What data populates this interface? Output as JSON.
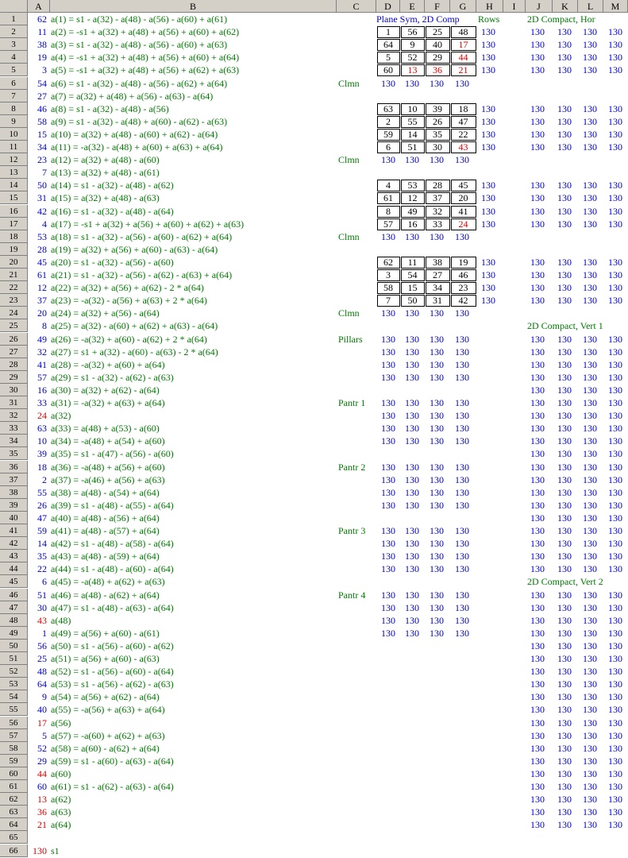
{
  "columns": [
    "A",
    "B",
    "C",
    "D",
    "E",
    "F",
    "G",
    "H",
    "I",
    "J",
    "K",
    "L",
    "M"
  ],
  "rows": [
    {
      "a": "62",
      "b": "a(1) = s1 - a(32) - a(48) - a(56) - a(60) + a(61)"
    },
    {
      "a": "11",
      "b": "a(2) = -s1 + a(32) + a(48) + a(56) + a(60) + a(62)"
    },
    {
      "a": "38",
      "b": "a(3) = s1 - a(32) - a(48) - a(56) - a(60) + a(63)"
    },
    {
      "a": "19",
      "b": "a(4) = -s1 + a(32) + a(48) + a(56) + a(60) + a(64)"
    },
    {
      "a": "3",
      "b": "a(5) = -s1 + a(32) + a(48) + a(56) + a(62) + a(63)"
    },
    {
      "a": "54",
      "b": "a(6) = s1 - a(32) - a(48) - a(56) - a(62) + a(64)"
    },
    {
      "a": "27",
      "b": "a(7) = a(32) + a(48) + a(56) - a(63) - a(64)"
    },
    {
      "a": "46",
      "b": "a(8) = s1 - a(32) - a(48) - a(56)"
    },
    {
      "a": "58",
      "b": "a(9) = s1 - a(32) - a(48) + a(60) - a(62) - a(63)"
    },
    {
      "a": "15",
      "b": "a(10) = a(32) + a(48) - a(60) + a(62) - a(64)"
    },
    {
      "a": "34",
      "b": "a(11) = -a(32) - a(48) + a(60) + a(63) + a(64)"
    },
    {
      "a": "23",
      "b": "a(12) = a(32) + a(48) - a(60)"
    },
    {
      "a": "7",
      "b": "a(13) = a(32) + a(48) - a(61)"
    },
    {
      "a": "50",
      "b": "a(14) = s1 - a(32) - a(48) - a(62)"
    },
    {
      "a": "31",
      "b": "a(15) = a(32) + a(48) - a(63)"
    },
    {
      "a": "42",
      "b": "a(16) = s1 - a(32) - a(48) - a(64)"
    },
    {
      "a": "4",
      "b": "a(17) = -s1 + a(32) + a(56) + a(60) + a(62) + a(63)"
    },
    {
      "a": "53",
      "b": "a(18) = s1 - a(32) - a(56) - a(60) - a(62) + a(64)"
    },
    {
      "a": "28",
      "b": "a(19) = a(32) + a(56) + a(60) - a(63) - a(64)"
    },
    {
      "a": "45",
      "b": "a(20) = s1 - a(32) - a(56) - a(60)"
    },
    {
      "a": "61",
      "b": "a(21) = s1 - a(32) - a(56) - a(62) - a(63) + a(64)"
    },
    {
      "a": "12",
      "b": "a(22) = a(32) + a(56) + a(62) - 2 * a(64)"
    },
    {
      "a": "37",
      "b": "a(23) = -a(32) - a(56) + a(63) + 2 * a(64)"
    },
    {
      "a": "20",
      "b": "a(24) = a(32) + a(56) - a(64)"
    },
    {
      "a": "8",
      "b": "a(25) = a(32) - a(60) + a(62) + a(63) - a(64)"
    },
    {
      "a": "49",
      "b": "a(26) = -a(32) + a(60) - a(62) + 2 * a(64)"
    },
    {
      "a": "32",
      "b": "a(27) = s1 + a(32) - a(60) - a(63) - 2 * a(64)"
    },
    {
      "a": "41",
      "b": "a(28) = -a(32) + a(60) + a(64)"
    },
    {
      "a": "57",
      "b": "a(29) = s1 - a(32) - a(62) - a(63)"
    },
    {
      "a": "16",
      "b": "a(30) = a(32) + a(62) - a(64)"
    },
    {
      "a": "33",
      "b": "a(31) = -a(32) + a(63) + a(64)"
    },
    {
      "a": "24",
      "b": "a(32)",
      "red": true
    },
    {
      "a": "63",
      "b": "a(33) = a(48) + a(53) - a(60)"
    },
    {
      "a": "10",
      "b": "a(34) = -a(48) + a(54) + a(60)"
    },
    {
      "a": "39",
      "b": "a(35) = s1 - a(47) - a(56) - a(60)"
    },
    {
      "a": "18",
      "b": "a(36) = -a(48) + a(56) + a(60)"
    },
    {
      "a": "2",
      "b": "a(37) = -a(46) + a(56) + a(63)"
    },
    {
      "a": "55",
      "b": "a(38) = a(48) - a(54) + a(64)"
    },
    {
      "a": "26",
      "b": "a(39) = s1 - a(48) - a(55) - a(64)"
    },
    {
      "a": "47",
      "b": "a(40) = a(48) - a(56) + a(64)"
    },
    {
      "a": "59",
      "b": "a(41) = a(48) - a(57) + a(64)"
    },
    {
      "a": "14",
      "b": "a(42) = s1 - a(48) - a(58) - a(64)"
    },
    {
      "a": "35",
      "b": "a(43) = a(48) - a(59) + a(64)"
    },
    {
      "a": "22",
      "b": "a(44) = s1 - a(48) - a(60) - a(64)"
    },
    {
      "a": "6",
      "b": "a(45) = -a(48) + a(62) + a(63)"
    },
    {
      "a": "51",
      "b": "a(46) = a(48) - a(62) + a(64)"
    },
    {
      "a": "30",
      "b": "a(47) = s1 - a(48) - a(63) - a(64)"
    },
    {
      "a": "43",
      "b": "a(48)",
      "red": true
    },
    {
      "a": "1",
      "b": "a(49) = a(56) + a(60) - a(61)"
    },
    {
      "a": "56",
      "b": "a(50) = s1 - a(56) - a(60) - a(62)"
    },
    {
      "a": "25",
      "b": "a(51) = a(56) + a(60) - a(63)"
    },
    {
      "a": "48",
      "b": "a(52) = s1 - a(56) - a(60) - a(64)"
    },
    {
      "a": "64",
      "b": "a(53) = s1 - a(56) - a(62) - a(63)"
    },
    {
      "a": "9",
      "b": "a(54) = a(56) + a(62) - a(64)"
    },
    {
      "a": "40",
      "b": "a(55) = -a(56) + a(63) + a(64)"
    },
    {
      "a": "17",
      "b": "a(56)",
      "red": true
    },
    {
      "a": "5",
      "b": "a(57) = -a(60) + a(62) + a(63)"
    },
    {
      "a": "52",
      "b": "a(58) = a(60) - a(62) + a(64)"
    },
    {
      "a": "29",
      "b": "a(59) = s1 - a(60) - a(63) - a(64)"
    },
    {
      "a": "44",
      "b": "a(60)",
      "red": true
    },
    {
      "a": "60",
      "b": "a(61) = s1 - a(62) - a(63) - a(64)"
    },
    {
      "a": "13",
      "b": "a(62)",
      "red": true
    },
    {
      "a": "36",
      "b": "a(63)",
      "red": true
    },
    {
      "a": "21",
      "b": "a(64)",
      "red": true
    },
    {
      "a": "",
      "b": ""
    },
    {
      "a": "130",
      "b": "s1",
      "red": true
    }
  ],
  "labels": {
    "plane_sym": "Plane Sym, 2D Comp",
    "rows": "Rows",
    "compact_hor": "2D Compact, Hor",
    "compact_vert1": "2D Compact, Vert 1",
    "compact_vert2": "2D Compact, Vert 2",
    "clmn": "Clmn",
    "pillars": "Pillars",
    "pantr1": "Pantr 1",
    "pantr2": "Pantr 2",
    "pantr3": "Pantr 3",
    "pantr4": "Pantr 4"
  },
  "squares": [
    [
      [
        "1",
        "56",
        "25",
        "48"
      ],
      [
        "64",
        "9",
        "40",
        "17"
      ],
      [
        "5",
        "52",
        "29",
        "44"
      ],
      [
        "60",
        "13",
        "36",
        "21"
      ]
    ],
    [
      [
        "63",
        "10",
        "39",
        "18"
      ],
      [
        "2",
        "55",
        "26",
        "47"
      ],
      [
        "59",
        "14",
        "35",
        "22"
      ],
      [
        "6",
        "51",
        "30",
        "43"
      ]
    ],
    [
      [
        "4",
        "53",
        "28",
        "45"
      ],
      [
        "61",
        "12",
        "37",
        "20"
      ],
      [
        "8",
        "49",
        "32",
        "41"
      ],
      [
        "57",
        "16",
        "33",
        "24"
      ]
    ],
    [
      [
        "62",
        "11",
        "38",
        "19"
      ],
      [
        "3",
        "54",
        "27",
        "46"
      ],
      [
        "58",
        "15",
        "34",
        "23"
      ],
      [
        "7",
        "50",
        "31",
        "42"
      ]
    ]
  ],
  "red_square_cells": [
    [
      [
        1,
        3
      ],
      [
        3,
        1
      ],
      [
        3,
        2
      ],
      [
        3,
        3
      ],
      [
        2,
        3
      ]
    ],
    [
      [
        3,
        3
      ]
    ],
    [
      [
        3,
        3
      ]
    ],
    []
  ],
  "sum": "130"
}
